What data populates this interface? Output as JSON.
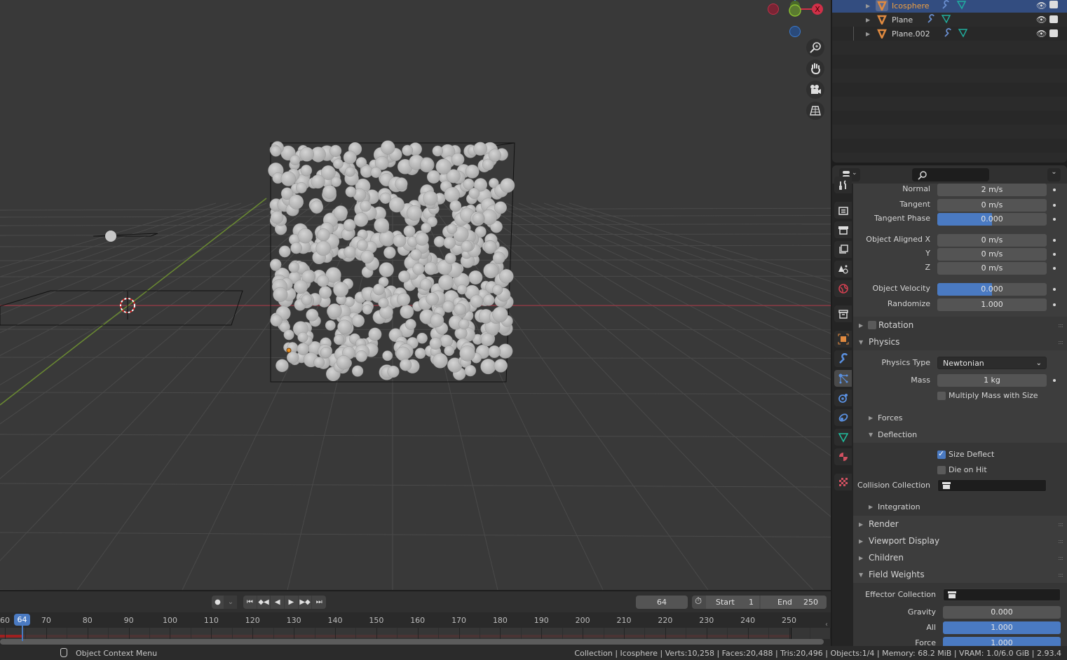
{
  "outliner": {
    "items": [
      {
        "name": "Icosphere",
        "selected": true
      },
      {
        "name": "Plane",
        "selected": false
      },
      {
        "name": "Plane.002",
        "selected": false
      }
    ]
  },
  "properties": {
    "search_placeholder": "",
    "velocity": {
      "normal_label": "Normal",
      "normal_value": "2 m/s",
      "tangent_label": "Tangent",
      "tangent_value": "0 m/s",
      "tangent_phase_label": "Tangent Phase",
      "tangent_phase_value": "0.000",
      "tangent_phase_fraction": 0.5,
      "object_aligned_x_label": "Object Aligned X",
      "object_aligned_x_value": "0 m/s",
      "y_label": "Y",
      "y_value": "0 m/s",
      "z_label": "Z",
      "z_value": "0 m/s",
      "object_velocity_label": "Object Velocity",
      "object_velocity_value": "0.000",
      "object_velocity_fraction": 0.5,
      "randomize_label": "Randomize",
      "randomize_value": "1.000"
    },
    "rotation_panel": {
      "label": "Rotation",
      "checked": false
    },
    "physics_panel": {
      "label": "Physics",
      "physics_type_label": "Physics Type",
      "physics_type_value": "Newtonian",
      "mass_label": "Mass",
      "mass_value": "1 kg",
      "multiply_mass_label": "Multiply Mass with Size",
      "multiply_mass_checked": false,
      "forces_label": "Forces",
      "deflection_label": "Deflection",
      "size_deflect_label": "Size Deflect",
      "size_deflect_checked": true,
      "die_on_hit_label": "Die on Hit",
      "die_on_hit_checked": false,
      "collision_collection_label": "Collision Collection",
      "integration_label": "Integration"
    },
    "panels": [
      "Render",
      "Viewport Display",
      "Children"
    ],
    "field_weights": {
      "label": "Field Weights",
      "effector_collection_label": "Effector Collection",
      "gravity_label": "Gravity",
      "gravity_value": "0.000",
      "all_label": "All",
      "all_value": "1.000",
      "force_label": "Force",
      "force_value": "1.000"
    }
  },
  "timeline": {
    "current_frame": "64",
    "start_label": "Start",
    "start_value": "1",
    "end_label": "End",
    "end_value": "250",
    "ticks": [
      "60",
      "70",
      "80",
      "90",
      "100",
      "110",
      "120",
      "130",
      "140",
      "150",
      "160",
      "170",
      "180",
      "190",
      "200",
      "210",
      "220",
      "230",
      "240",
      "250"
    ],
    "playhead_label": "64"
  },
  "statusbar": {
    "hint": "Object Context Menu",
    "stats": "Collection | Icosphere | Verts:10,258 | Faces:20,488 | Tris:20,496 | Objects:1/4 | Memory: 68.2 MiB | VRAM: 1.0/6.0 GiB | 2.93.4"
  },
  "gizmo": {
    "x_label": "X"
  }
}
